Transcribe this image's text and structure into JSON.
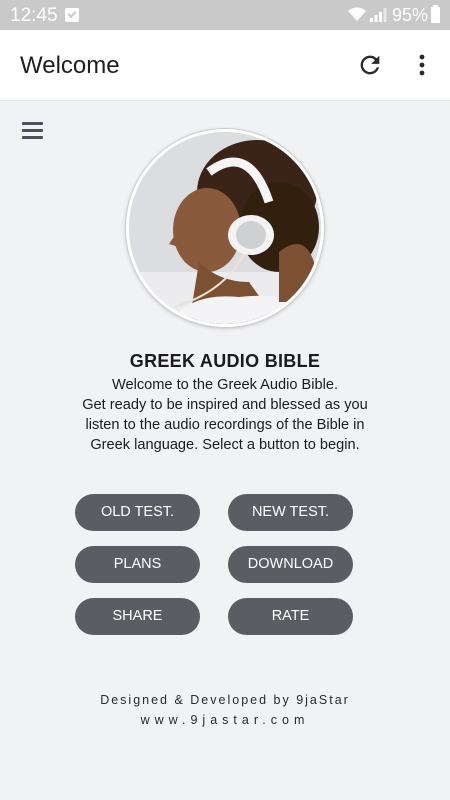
{
  "status_bar": {
    "time": "12:45",
    "battery": "95%",
    "icons": [
      "notification-check-icon",
      "wifi-icon",
      "signal-icon",
      "battery-icon"
    ]
  },
  "app_bar": {
    "title": "Welcome",
    "icons": [
      "refresh-icon",
      "more-vert-icon"
    ]
  },
  "menu": {
    "icon": "hamburger-menu-icon"
  },
  "hero": {
    "image": "woman-with-headphones-photo"
  },
  "content": {
    "heading": "GREEK AUDIO BIBLE",
    "description_lines": [
      "Welcome to the Greek Audio Bible.",
      "Get ready to be inspired and blessed as you",
      "listen to the audio recordings of the Bible in",
      "Greek language. Select a button to begin."
    ]
  },
  "buttons": {
    "old_test": "OLD TEST.",
    "new_test": "NEW TEST.",
    "plans": "PLANS",
    "download": "DOWNLOAD",
    "share": "SHARE",
    "rate": "RATE"
  },
  "footer": {
    "credit": "Designed & Developed by 9jaStar",
    "website": "www.9jastar.com"
  },
  "colors": {
    "status_bar": "#c9c9c9",
    "background": "#f1f2f4",
    "button": "#5a5e63",
    "button_text": "#ffffff"
  }
}
